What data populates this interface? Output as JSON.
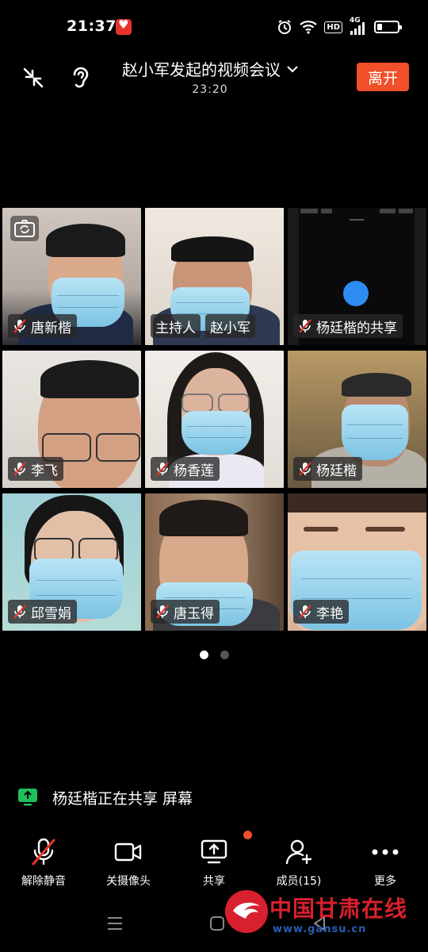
{
  "status_bar": {
    "time": "21:37",
    "network": "4G",
    "hd": "HD"
  },
  "meeting": {
    "title": "赵小军发起的视频会议",
    "timer": "23:20",
    "leave_label": "离开"
  },
  "participants": [
    {
      "name": "唐新楷",
      "muted": true
    },
    {
      "host_label": "主持人",
      "name": "赵小军",
      "muted": false
    },
    {
      "name": "杨廷楷的共享",
      "muted": true
    },
    {
      "name": "李飞",
      "muted": true
    },
    {
      "name": "杨香莲",
      "muted": true
    },
    {
      "name": "杨廷楷",
      "muted": true
    },
    {
      "name": "邱雪娟",
      "muted": true
    },
    {
      "name": "唐玉得",
      "muted": true
    },
    {
      "name": "李艳",
      "muted": true
    }
  ],
  "pagination": {
    "pages": 2,
    "current": 1
  },
  "share_notice": "杨廷楷正在共享 屏幕",
  "toolbar": {
    "unmute_label": "解除静音",
    "camera_label": "关摄像头",
    "share_label": "共享",
    "members_label": "成员(15)",
    "more_label": "更多"
  },
  "watermark": {
    "text": "中国甘肃在线",
    "url": "www.gansu.cn"
  },
  "colors": {
    "accent": "#f0502a",
    "share_green": "#1fbf5c",
    "mute_red": "#e8332a"
  }
}
